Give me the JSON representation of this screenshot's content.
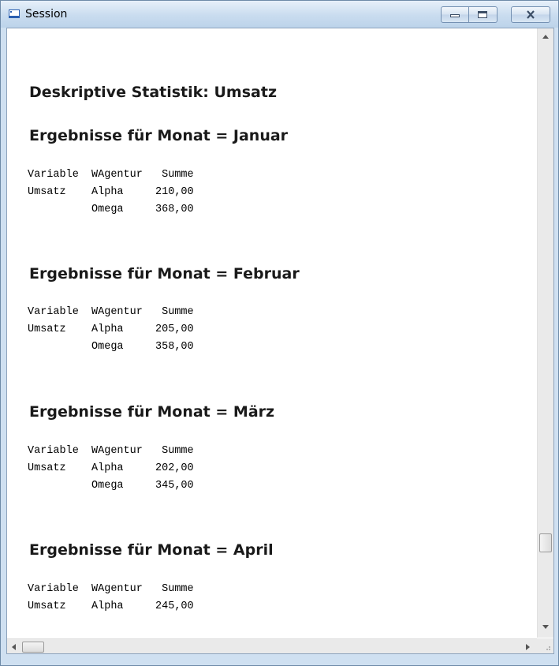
{
  "window": {
    "title": "Session",
    "icons": {
      "app": "session-window-icon",
      "minimize": "minimize-icon",
      "maximize": "maximize-icon",
      "close": "close-icon"
    }
  },
  "report": {
    "title": "Deskriptive Statistik: Umsatz",
    "sections": [
      {
        "heading": "Ergebnisse für Monat = Januar",
        "header_row": "Variable  WAgentur   Summe",
        "rows": [
          "Umsatz    Alpha     210,00",
          "          Omega     368,00"
        ]
      },
      {
        "heading": "Ergebnisse für Monat = Februar",
        "header_row": "Variable  WAgentur   Summe",
        "rows": [
          "Umsatz    Alpha     205,00",
          "          Omega     358,00"
        ]
      },
      {
        "heading": "Ergebnisse für Monat = März",
        "header_row": "Variable  WAgentur   Summe",
        "rows": [
          "Umsatz    Alpha     202,00",
          "          Omega     345,00"
        ]
      },
      {
        "heading": "Ergebnisse für Monat = April",
        "header_row": "Variable  WAgentur   Summe",
        "rows": [
          "Umsatz    Alpha     245,00"
        ]
      }
    ]
  },
  "scrollbars": {
    "vertical_icons": [
      "scroll-up-icon",
      "scroll-down-icon"
    ],
    "horizontal_icons": [
      "scroll-left-icon",
      "scroll-right-icon"
    ]
  },
  "colors": {
    "title_gradient_top": "#e7f0fa",
    "title_gradient_bottom": "#bcd3ea",
    "window_border": "#6e8aa8",
    "heading_text": "#1a1a1a"
  }
}
